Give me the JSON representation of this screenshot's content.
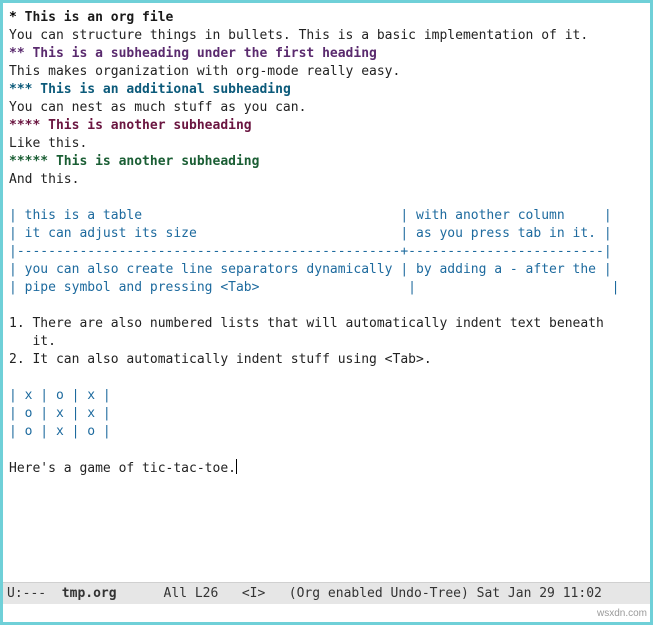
{
  "headings": {
    "h1_stars": "*",
    "h1_text": " This is an org file",
    "h1_body": "You can structure things in bullets. This is a basic implementation of it.",
    "h2_stars": "**",
    "h2_text": " This is a subheading under the first heading",
    "h2_body": "This makes organization with org-mode really easy.",
    "h3_stars": "***",
    "h3_text": " This is an additional subheading",
    "h3_body": "You can nest as much stuff as you can.",
    "h4_stars": "****",
    "h4_text": " This is another subheading",
    "h4_body": "Like this.",
    "h5_stars": "*****",
    "h5_text": " This is another subheading",
    "h5_body": "And this."
  },
  "table1": {
    "r1": "| this is a table                                 | with another column     |",
    "r2": "| it can adjust its size                          | as you press tab in it. |",
    "r3": "|-------------------------------------------------+-------------------------|",
    "r4": "| you can also create line separators dynamically | by adding a - after the |",
    "r5": "| pipe symbol and pressing <Tab>                   |                         |"
  },
  "list": {
    "i1a": "1. There are also numbered lists that will automatically indent text beneath",
    "i1b": "   it.",
    "i2": "2. It can also automatically indent stuff using <Tab>."
  },
  "table2": {
    "r1": "| x | o | x |",
    "r2": "| o | x | x |",
    "r3": "| o | x | o |"
  },
  "footer_text": "Here's a game of tic-tac-toe.",
  "modeline": {
    "left": "U:---  ",
    "file": "tmp.org",
    "rest": "      All L26   <I>   (Org enabled Undo-Tree) Sat Jan 29 11:02"
  },
  "watermark": "wsxdn.com"
}
